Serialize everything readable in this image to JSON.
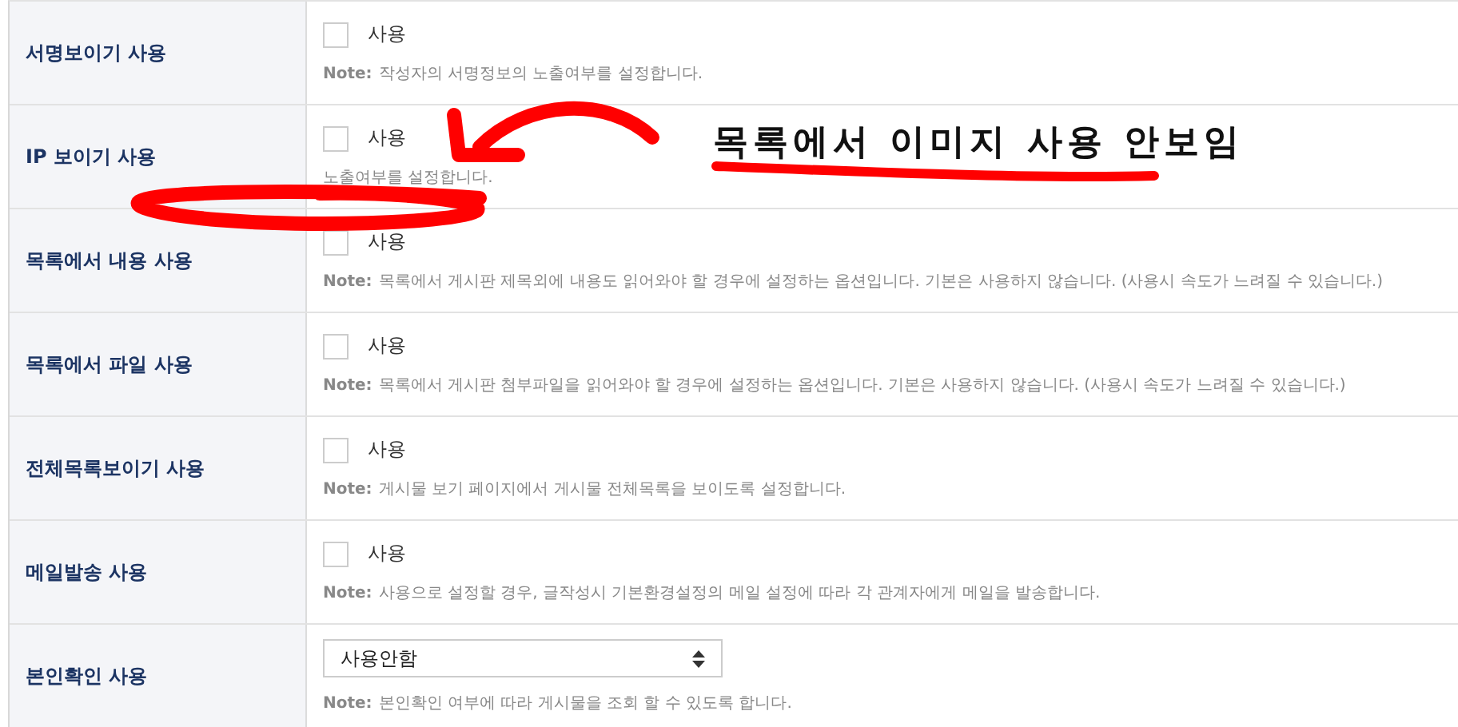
{
  "rows": [
    {
      "label": "서명보이기 사용",
      "kind": "checkbox",
      "checked": false,
      "option": "사용",
      "note_prefix": "Note:",
      "note": "작성자의 서명정보의 노출여부를 설정합니다."
    },
    {
      "label": "IP 보이기 사용",
      "kind": "checkbox",
      "checked": false,
      "option": "사용",
      "note": "노출여부를 설정합니다."
    },
    {
      "label": "목록에서 내용 사용",
      "kind": "checkbox",
      "checked": false,
      "option": "사용",
      "note_prefix": "Note:",
      "note": "목록에서 게시판 제목외에 내용도 읽어와야 할 경우에 설정하는 옵션입니다. 기본은 사용하지 않습니다. (사용시 속도가 느려질 수 있습니다.)"
    },
    {
      "label": "목록에서 파일 사용",
      "kind": "checkbox",
      "checked": false,
      "option": "사용",
      "note_prefix": "Note:",
      "note": "목록에서 게시판 첨부파일을 읽어와야 할 경우에 설정하는 옵션입니다. 기본은 사용하지 않습니다. (사용시 속도가 느려질 수 있습니다.)"
    },
    {
      "label": "전체목록보이기 사용",
      "kind": "checkbox",
      "checked": false,
      "option": "사용",
      "note_prefix": "Note:",
      "note": "게시물 보기 페이지에서 게시물 전체목록을 보이도록 설정합니다."
    },
    {
      "label": "메일발송 사용",
      "kind": "checkbox",
      "checked": false,
      "option": "사용",
      "note_prefix": "Note:",
      "note": "사용으로 설정할 경우, 글작성시 기본환경설정의 메일 설정에 따라 각 관계자에게 메일을 발송합니다."
    },
    {
      "label": "본인확인 사용",
      "kind": "select",
      "value": "사용안함",
      "note_prefix": "Note:",
      "note": "본인확인 여부에 따라 게시물을 조회 할 수 있도록 합니다."
    }
  ],
  "annotation": {
    "text": "목록에서 이미지 사용 안보임"
  }
}
